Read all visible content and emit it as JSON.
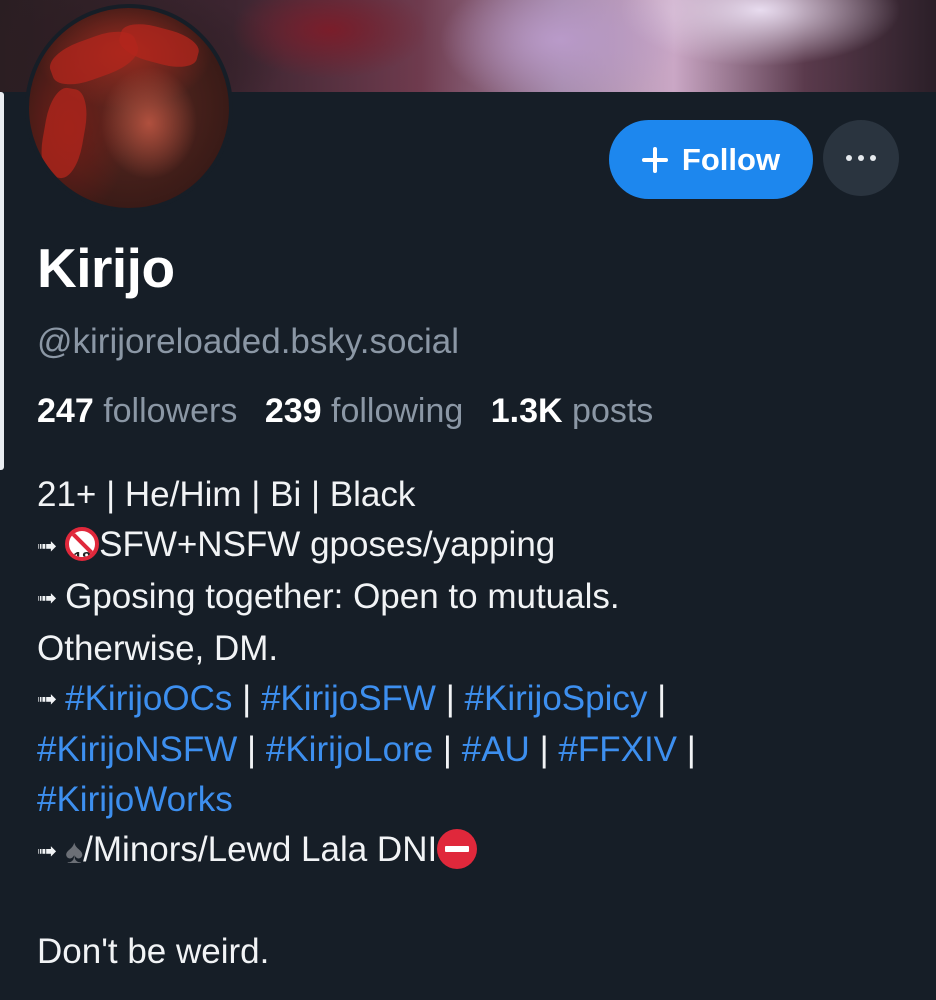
{
  "profile": {
    "display_name": "Kirijo",
    "handle": "@kirijoreloaded.bsky.social",
    "follow_label": "Follow",
    "more_icon": "more-horizontal-icon",
    "accent_color": "#1d87ee"
  },
  "stats": {
    "followers_count": "247",
    "followers_label": "followers",
    "following_count": "239",
    "following_label": "following",
    "posts_count": "1.3K",
    "posts_label": "posts"
  },
  "bio": {
    "line1": "21+ | He/Him | Bi | Black",
    "line2_text": "SFW+NSFW gposes/yapping",
    "line3": "Gposing together: Open to mutuals.",
    "line4": "Otherwise, DM.",
    "hashtags": [
      "#KirijoOCs",
      "#KirijoSFW",
      "#KirijoSpicy",
      "#KirijoNSFW",
      "#KirijoLore",
      "#AU",
      "#FFXIV",
      "#KirijoWorks"
    ],
    "line_dni": "/Minors/Lewd Lala DNI",
    "closing": "Don't be weird.",
    "no18_text": "18",
    "arrow": "➟",
    "separator": "|"
  }
}
